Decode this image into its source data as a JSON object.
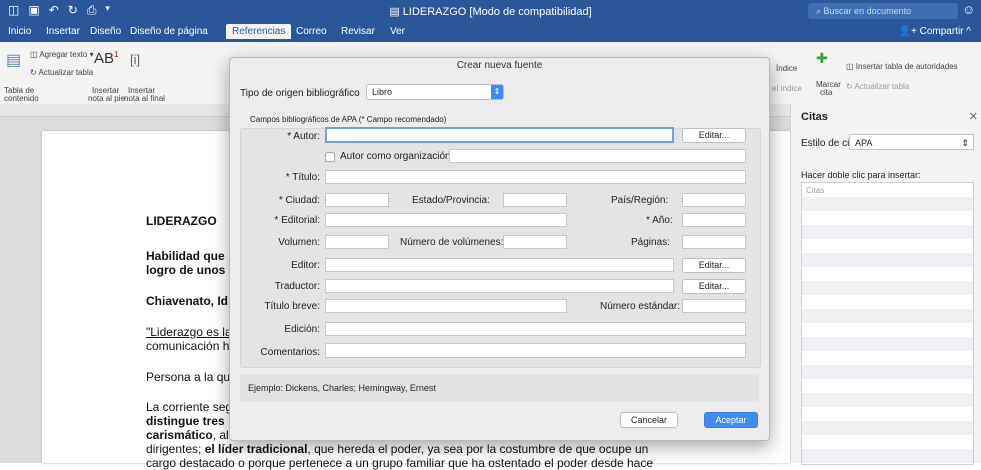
{
  "titlebar": {
    "doc_title": "LIDERAZGO [Modo de compatibilidad]",
    "search_placeholder": "Buscar en documento",
    "qa_icons": [
      "sidebar-icon",
      "save-icon",
      "undo-icon",
      "redo-icon",
      "print-icon",
      "more-icon"
    ]
  },
  "tabs": [
    "Inicio",
    "Insertar",
    "Diseño",
    "Diseño de página",
    "Referencias",
    "Correo",
    "Revisar",
    "Ver"
  ],
  "active_tab": "Referencias",
  "share": "Compartir",
  "ribbon": {
    "add_text": "Agregar texto",
    "update_table": "Actualizar tabla",
    "toc_line1": "Tabla de",
    "toc_line2": "contenido",
    "ab": "AB",
    "footnote_line1": "Insertar",
    "footnote_line2": "nota al pie",
    "endnote_line1": "Insertar",
    "endnote_line2": "nota al final",
    "index": "Índice",
    "index2": "el índice",
    "mark_line1": "Marcar",
    "mark_line2": "cita",
    "insert_toa": "Insertar tabla de autoridades",
    "update_toa": "Actualizar tabla"
  },
  "document": {
    "heading": "LIDERAZGO",
    "line1": "Habilidad que",
    "line2": "logro de unos",
    "line3": "Chiavenato, Id",
    "line4": "\"Liderazgo es la",
    "line5": "comunicación h",
    "line6": "Persona a la qu",
    "line7": "La corriente seg",
    "line8": "distingue tres",
    "line9_bold": "carismático",
    "line9_rest": ", al",
    "line10_a": "dirigentes; ",
    "line10_bold": "el líder tradicional",
    "line10_c": ", que hereda el poder, ya sea por la costumbre de que ocupe un",
    "line11": "cargo destacado o porque pertenece a un grupo familiar que ha ostentado el poder desde hace"
  },
  "pane": {
    "title": "Citas",
    "style_label": "Estilo de cita:",
    "style_value": "APA",
    "hint": "Hacer doble clic para insertar:",
    "list_header": "Citas"
  },
  "dialog": {
    "title": "Crear nueva fuente",
    "source_type_label": "Tipo de origen bibliográfico",
    "source_type_value": "Libro",
    "fields_header": "Campos bibliográficos de APA (* Campo recomendado)",
    "autor": "* Autor:",
    "autor_org": "Autor como organización:",
    "titulo": "* Título:",
    "ciudad": "* Ciudad:",
    "estado": "Estado/Provincia:",
    "pais": "País/Región:",
    "editorial": "* Editorial:",
    "anio": "* Año:",
    "volumen": "Volumen:",
    "num_volumenes": "Número de volúmenes:",
    "paginas": "Páginas:",
    "editor": "Editor:",
    "traductor": "Traductor:",
    "titulo_breve": "Título breve:",
    "numero_estandar": "Número estándar:",
    "edicion": "Edición:",
    "comentarios": "Comentarios:",
    "edit_button": "Editar...",
    "example": "Ejemplo: Dickens, Charles; Hemingway, Ernest",
    "cancel": "Cancelar",
    "accept": "Aceptar"
  }
}
